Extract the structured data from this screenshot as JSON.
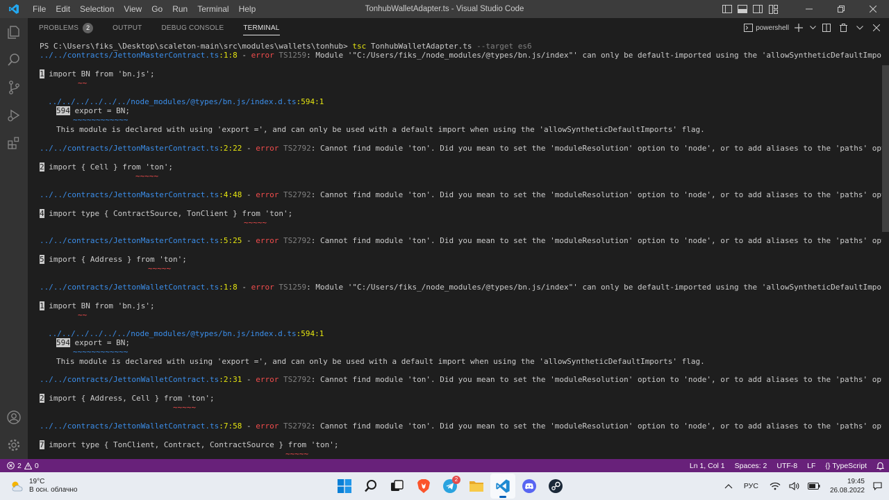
{
  "titlebar": {
    "menu": [
      "File",
      "Edit",
      "Selection",
      "View",
      "Go",
      "Run",
      "Terminal",
      "Help"
    ],
    "title": "TonhubWalletAdapter.ts - Visual Studio Code"
  },
  "panel": {
    "tabs": {
      "problems": "PROBLEMS",
      "problems_count": "2",
      "output": "OUTPUT",
      "debug_console": "DEBUG CONSOLE",
      "terminal": "TERMINAL"
    },
    "shell": "powershell"
  },
  "terminal": {
    "prompt": "PS C:\\Users\\fiks_\\Desktop\\scaleton-main\\src\\modules\\wallets\\tonhub>",
    "cmd": "tsc",
    "cmd_file": "TonhubWalletAdapter.ts",
    "cmd_args": "--target es6",
    "lines": {
      "e1_file": "../../contracts/JettonMasterContract.ts",
      "e1_loc": ":1:8",
      "e1_code": "TS1259",
      "e1_msg": ": Module '\"C:/Users/fiks_/node_modules/@types/bn.js/index\"' can only be default-imported using the 'allowSyntheticDefaultImports' flag",
      "e1_gut": "1",
      "e1_src": "import BN from 'bn.js';",
      "e1_sq": "~~",
      "e1_ref_file": "../../../../../../node_modules/@types/bn.js/index.d.ts",
      "e1_ref_loc": ":594:1",
      "e1_ref_gut": "594",
      "e1_ref_src": "export = BN;",
      "e1_ref_sq": "~~~~~~~~~~~~",
      "e1_note": "This module is declared with using 'export =', and can only be used with a default import when using the 'allowSyntheticDefaultImports' flag.",
      "e2_file": "../../contracts/JettonMasterContract.ts",
      "e2_loc": ":2:22",
      "e2_code": "TS2792",
      "e2_msg": ": Cannot find module 'ton'. Did you mean to set the 'moduleResolution' option to 'node', or to add aliases to the 'paths' option?",
      "e2_gut": "2",
      "e2_src": "import { Cell } from 'ton';",
      "e2_sq": "~~~~~",
      "e3_file": "../../contracts/JettonMasterContract.ts",
      "e3_loc": ":4:48",
      "e3_code": "TS2792",
      "e3_msg": ": Cannot find module 'ton'. Did you mean to set the 'moduleResolution' option to 'node', or to add aliases to the 'paths' option?",
      "e3_gut": "4",
      "e3_src": "import type { ContractSource, TonClient } from 'ton';",
      "e3_sq": "~~~~~",
      "e4_file": "../../contracts/JettonMasterContract.ts",
      "e4_loc": ":5:25",
      "e4_code": "TS2792",
      "e4_msg": ": Cannot find module 'ton'. Did you mean to set the 'moduleResolution' option to 'node', or to add aliases to the 'paths' option?",
      "e4_gut": "5",
      "e4_src": "import { Address } from 'ton';",
      "e4_sq": "~~~~~",
      "e5_file": "../../contracts/JettonWalletContract.ts",
      "e5_loc": ":1:8",
      "e5_code": "TS1259",
      "e5_msg": ": Module '\"C:/Users/fiks_/node_modules/@types/bn.js/index\"' can only be default-imported using the 'allowSyntheticDefaultImports' flag",
      "e5_gut": "1",
      "e5_src": "import BN from 'bn.js';",
      "e5_sq": "~~",
      "e5_ref_file": "../../../../../../node_modules/@types/bn.js/index.d.ts",
      "e5_ref_loc": ":594:1",
      "e5_ref_gut": "594",
      "e5_ref_src": "export = BN;",
      "e5_ref_sq": "~~~~~~~~~~~~",
      "e5_note": "This module is declared with using 'export =', and can only be used with a default import when using the 'allowSyntheticDefaultImports' flag.",
      "e6_file": "../../contracts/JettonWalletContract.ts",
      "e6_loc": ":2:31",
      "e6_code": "TS2792",
      "e6_msg": ": Cannot find module 'ton'. Did you mean to set the 'moduleResolution' option to 'node', or to add aliases to the 'paths' option?",
      "e6_gut": "2",
      "e6_src": "import { Address, Cell } from 'ton';",
      "e6_sq": "~~~~~",
      "e7_file": "../../contracts/JettonWalletContract.ts",
      "e7_loc": ":7:58",
      "e7_code": "TS2792",
      "e7_msg": ": Cannot find module 'ton'. Did you mean to set the 'moduleResolution' option to 'node', or to add aliases to the 'paths' option?",
      "e7_gut": "7",
      "e7_src": "import type { TonClient, Contract, ContractSource } from 'ton';",
      "e7_sq": "~~~~~",
      "error_word": "error",
      "dash": " - "
    }
  },
  "statusbar": {
    "errors": "2",
    "warnings": "0",
    "position": "Ln 1, Col 1",
    "spaces": "Spaces: 2",
    "encoding": "UTF-8",
    "eol": "LF",
    "language": "TypeScript"
  },
  "taskbar": {
    "temp": "19°C",
    "weather": "В осн. облачно",
    "lang": "РУС",
    "time": "19:45",
    "date": "26.08.2022",
    "telegram_badge": "2"
  },
  "colors": {
    "statusbar": "#68217a",
    "error": "#f14c4c",
    "file_link": "#3b8eea",
    "location": "#e5e510"
  }
}
